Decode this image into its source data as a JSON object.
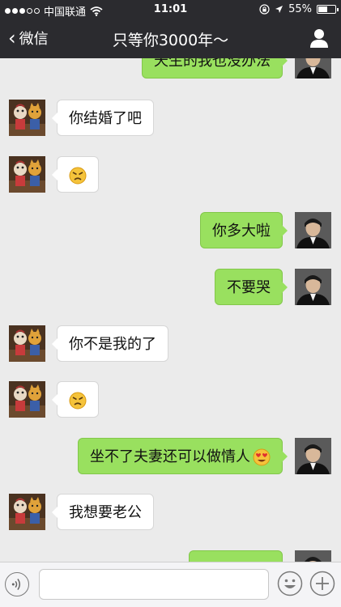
{
  "status_bar": {
    "carrier": "中国联通",
    "time": "11:01",
    "battery": "55%",
    "battery_fraction": 0.55
  },
  "nav": {
    "back_label": "微信",
    "title": "只等你3000年～"
  },
  "messages": [
    {
      "side": "out",
      "text": "天生的我也没办法",
      "emoji": ""
    },
    {
      "side": "in",
      "text": "你结婚了吧",
      "emoji": ""
    },
    {
      "side": "in",
      "text": "",
      "emoji": "angry"
    },
    {
      "side": "out",
      "text": "你多大啦",
      "emoji": ""
    },
    {
      "side": "out",
      "text": "不要哭",
      "emoji": ""
    },
    {
      "side": "in",
      "text": "你不是我的了",
      "emoji": ""
    },
    {
      "side": "in",
      "text": "",
      "emoji": "angry"
    },
    {
      "side": "out",
      "text": "坐不了夫妻还可以做情人",
      "emoji": "heart-eyes"
    },
    {
      "side": "in",
      "text": "我想要老公",
      "emoji": ""
    },
    {
      "side": "out",
      "text": "",
      "emoji": ""
    }
  ],
  "colors": {
    "outgoing_bubble": "#99e05f",
    "incoming_bubble": "#ffffff",
    "nav_background": "#2b2b2f"
  }
}
